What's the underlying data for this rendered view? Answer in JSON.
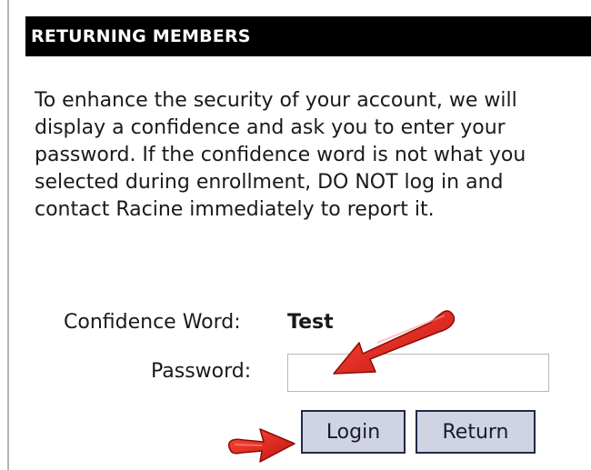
{
  "header": {
    "title": "RETURNING MEMBERS"
  },
  "intro": {
    "text": "To enhance the security of your account, we will display a confidence and ask you to enter your password. If the confidence word is not what you selected during enrollment, DO NOT log in and contact Racine immediately to report it."
  },
  "form": {
    "confidence_label": "Confidence Word:",
    "confidence_value": "Test",
    "password_label": "Password:",
    "password_value": "",
    "login_label": "Login",
    "return_label": "Return"
  },
  "annotations": {
    "arrow_color": "#e0211b",
    "arrows": [
      "arrow-pointing-to-password-field",
      "arrow-pointing-to-login-button"
    ]
  }
}
